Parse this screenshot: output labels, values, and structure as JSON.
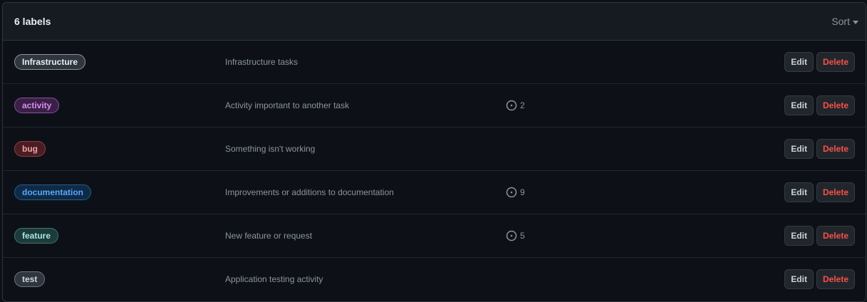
{
  "header": {
    "count_text": "6 labels",
    "sort_label": "Sort"
  },
  "labels": [
    {
      "name": "Infrastructure",
      "description": "Infrastructure tasks",
      "issues": "",
      "bg": "#30363d",
      "border": "#8b949e",
      "text": "#e6edf3"
    },
    {
      "name": "activity",
      "description": "Activity important to another task",
      "issues": "2",
      "bg": "#3b1f46",
      "border": "#8a4ea0",
      "text": "#d98ef0"
    },
    {
      "name": "bug",
      "description": "Something isn't working",
      "issues": "",
      "bg": "#4a1d22",
      "border": "#8e3d45",
      "text": "#f0a0a8"
    },
    {
      "name": "documentation",
      "description": "Improvements or additions to documentation",
      "issues": "9",
      "bg": "#0f2a44",
      "border": "#1f5e96",
      "text": "#58a6ff"
    },
    {
      "name": "feature",
      "description": "New feature or request",
      "issues": "5",
      "bg": "#1d3b3b",
      "border": "#3f7575",
      "text": "#a8e6e0"
    },
    {
      "name": "test",
      "description": "Application testing activity",
      "issues": "",
      "bg": "#30363d",
      "border": "#6e7681",
      "text": "#d0d7de"
    }
  ],
  "actions": {
    "edit_label": "Edit",
    "delete_label": "Delete"
  },
  "icons": {
    "issue": "issue-opened-icon",
    "sort": "caret-down-icon"
  }
}
